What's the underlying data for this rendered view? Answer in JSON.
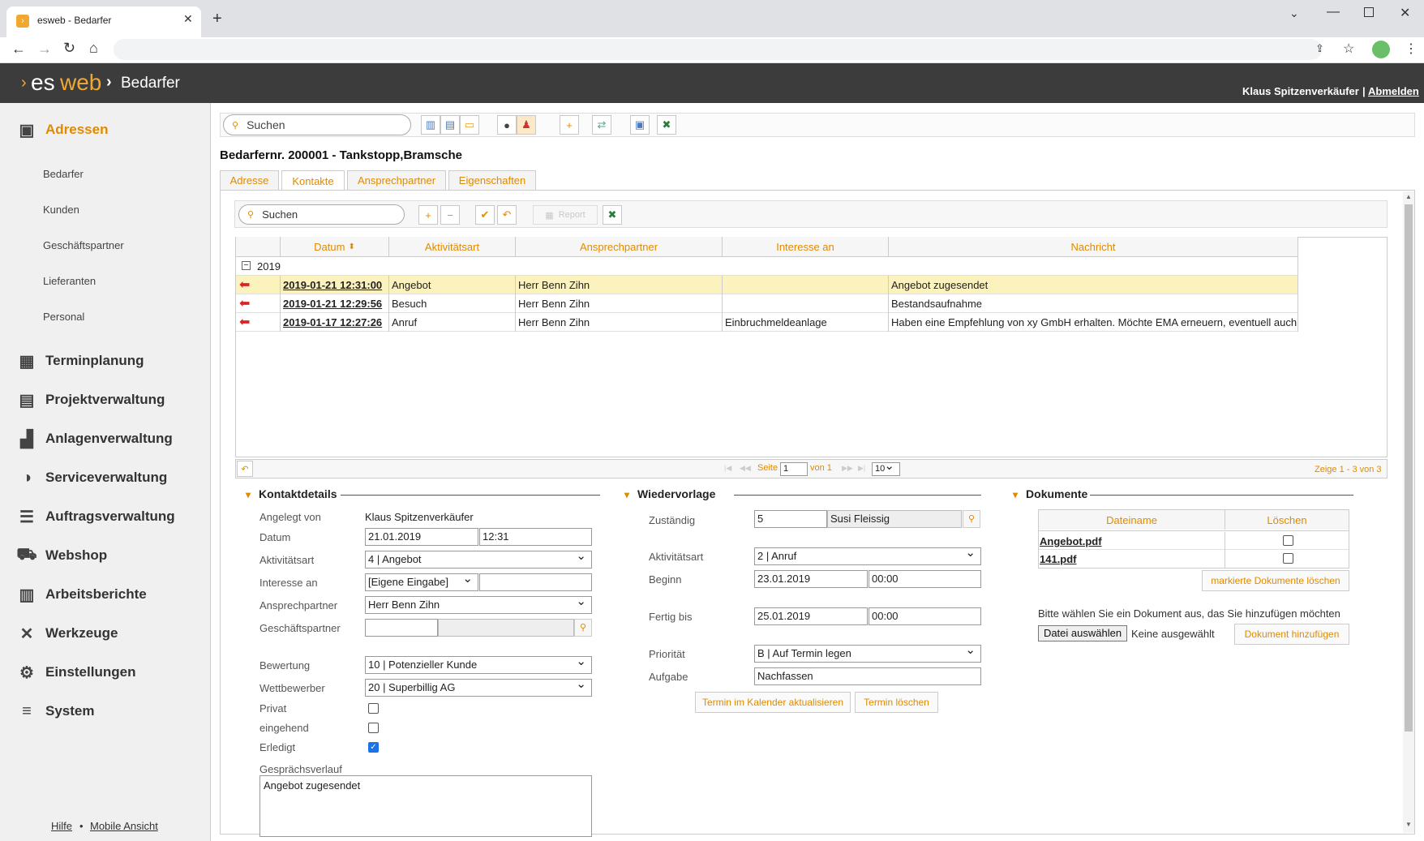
{
  "browser": {
    "tab_title": "esweb - Bedarfer",
    "new_tab_symbol": "+"
  },
  "header": {
    "logo_es": "es",
    "logo_web": "web",
    "section": "Bedarfer",
    "user": "Klaus Spitzenverkäufer",
    "separator": "|",
    "logout": "Abmelden"
  },
  "sidebar": {
    "active": "Adressen",
    "sub_items": [
      "Bedarfer",
      "Kunden",
      "Geschäftspartner",
      "Lieferanten",
      "Personal"
    ],
    "items": [
      "Terminplanung",
      "Projektverwaltung",
      "Anlagenverwaltung",
      "Serviceverwaltung",
      "Auftragsverwaltung",
      "Webshop",
      "Arbeitsberichte",
      "Werkzeuge",
      "Einstellungen",
      "System"
    ],
    "footer_help": "Hilfe",
    "footer_sep": "•",
    "footer_mobile": "Mobile Ansicht"
  },
  "search": {
    "placeholder": "Suchen"
  },
  "page_title": "Bedarfernr. 200001 - Tankstopp,Bramsche",
  "tabs": [
    "Adresse",
    "Kontakte",
    "Ansprechpartner",
    "Eigenschaften"
  ],
  "grid_toolbar": {
    "search_placeholder": "Suchen",
    "report": "Report"
  },
  "grid": {
    "columns": [
      "Datum",
      "Aktivitätsart",
      "Ansprechpartner",
      "Interesse an",
      "Nachricht"
    ],
    "group": "2019",
    "rows": [
      {
        "datum": "2019-01-21 12:31:00",
        "art": "Angebot",
        "partner": "Herr Benn Zihn",
        "interesse": "",
        "nachricht": "Angebot zugesendet"
      },
      {
        "datum": "2019-01-21 12:29:56",
        "art": "Besuch",
        "partner": "Herr Benn Zihn",
        "interesse": "",
        "nachricht": "Bestandsaufnahme"
      },
      {
        "datum": "2019-01-17 12:27:26",
        "art": "Anruf",
        "partner": "Herr Benn Zihn",
        "interesse": "Einbruchmeldeanlage",
        "nachricht": "Haben eine Empfehlung von xy GmbH erhalten. Möchte EMA erneuern, eventuell auch d"
      }
    ],
    "pager": {
      "seite": "Seite",
      "page": "1",
      "von": "von 1",
      "size": "10",
      "summary": "Zeige 1 - 3 von 3"
    }
  },
  "kontaktdetails": {
    "title": "Kontaktdetails",
    "angelegt_label": "Angelegt von",
    "angelegt_value": "Klaus Spitzenverkäufer",
    "datum_label": "Datum",
    "datum_value": "21.01.2019",
    "zeit_value": "12:31",
    "art_label": "Aktivitätsart",
    "art_value": "4 | Angebot",
    "interesse_label": "Interesse an",
    "interesse_value": "[Eigene Eingabe]",
    "ansprech_label": "Ansprechpartner",
    "ansprech_value": "Herr Benn Zihn",
    "geschaeft_label": "Geschäftspartner",
    "bewertung_label": "Bewertung",
    "bewertung_value": "10 | Potenzieller Kunde",
    "wettbewerber_label": "Wettbewerber",
    "wettbewerber_value": "20 | Superbillig AG",
    "privat_label": "Privat",
    "eingehend_label": "eingehend",
    "erledigt_label": "Erledigt",
    "verlauf_label": "Gesprächsverlauf",
    "verlauf_value": "Angebot zugesendet"
  },
  "wiedervorlage": {
    "title": "Wiedervorlage",
    "zustaendig_label": "Zuständig",
    "zustaendig_id": "5",
    "zustaendig_name": "Susi Fleissig",
    "art_label": "Aktivitätsart",
    "art_value": "2 | Anruf",
    "beginn_label": "Beginn",
    "beginn_date": "23.01.2019",
    "beginn_time": "00:00",
    "fertig_label": "Fertig bis",
    "fertig_date": "25.01.2019",
    "fertig_time": "00:00",
    "prio_label": "Priorität",
    "prio_value": "B | Auf Termin legen",
    "aufgabe_label": "Aufgabe",
    "aufgabe_value": "Nachfassen",
    "btn_update": "Termin im Kalender aktualisieren",
    "btn_delete": "Termin löschen"
  },
  "dokumente": {
    "title": "Dokumente",
    "col_name": "Dateiname",
    "col_delete": "Löschen",
    "files": [
      "Angebot.pdf",
      "141.pdf"
    ],
    "btn_delete_marked": "markierte Dokumente löschen",
    "choose_hint": "Bitte wählen Sie ein Dokument aus, das Sie hinzufügen möchten",
    "btn_choose": "Datei auswählen",
    "none_selected": "Keine ausgewählt",
    "btn_add": "Dokument hinzufügen"
  },
  "colors": {
    "accent": "#e08a00",
    "header_bg": "#3c3c3c",
    "highlight_row": "#fbf2bd"
  }
}
